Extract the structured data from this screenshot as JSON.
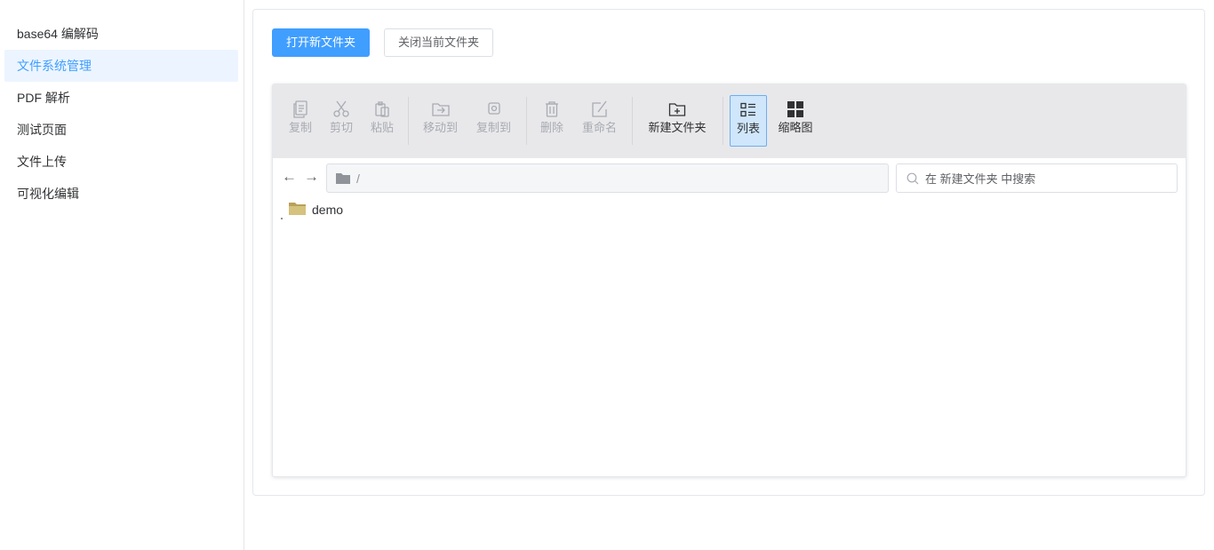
{
  "sidebar": {
    "items": [
      {
        "label": "base64 编解码",
        "active": false
      },
      {
        "label": "文件系统管理",
        "active": true
      },
      {
        "label": "PDF 解析",
        "active": false
      },
      {
        "label": "测试页面",
        "active": false
      },
      {
        "label": "文件上传",
        "active": false
      },
      {
        "label": "可视化编辑",
        "active": false
      }
    ]
  },
  "actions": {
    "open_label": "打开新文件夹",
    "close_label": "关闭当前文件夹"
  },
  "toolbar": {
    "copy": "复制",
    "cut": "剪切",
    "paste": "粘贴",
    "move_to": "移动到",
    "copy_to": "复制到",
    "delete": "删除",
    "rename": "重命名",
    "new_folder": "新建文件夹",
    "list_view": "列表",
    "thumbnail_view": "缩略图"
  },
  "address": {
    "path": "/",
    "search_placeholder": "在 新建文件夹 中搜索"
  },
  "files": [
    {
      "name": "demo",
      "icon": "folder-icon"
    }
  ],
  "colors": {
    "accent": "#409eff",
    "toolbar_bg": "#e8e8ea",
    "folder": "#c9b36b"
  }
}
